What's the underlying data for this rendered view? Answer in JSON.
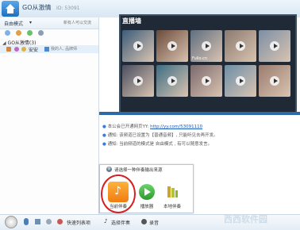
{
  "window": {
    "title": "GO从激情",
    "room_id": "ID: 53091"
  },
  "left_panel": {
    "mode_label": "自由模式",
    "remind_label": "新有人可以交流",
    "group_header": "GO从激情(3)",
    "user": {
      "name": "安安",
      "desc": "我的人, 品牌师"
    }
  },
  "video_area": {
    "title": "直播墙",
    "thumbs": [
      {
        "label": "",
        "color": "#3c5c7a"
      },
      {
        "label": "",
        "color": "#6b4a3a"
      },
      {
        "label": "Fulio.cn",
        "color": "#5f6e80"
      },
      {
        "label": "",
        "color": "#8a7a70"
      },
      {
        "label": "",
        "color": "#7c8fa5"
      },
      {
        "label": "",
        "color": "#4a4f60"
      },
      {
        "label": "",
        "color": "#3d6d84"
      },
      {
        "label": "",
        "color": "#7b6a6f"
      },
      {
        "label": "",
        "color": "#6d8fa8"
      },
      {
        "label": "",
        "color": "#9a7d70"
      }
    ]
  },
  "messages": [
    {
      "prefix": "本公会已开通网页YY:",
      "link": "http://yy.com/53091110"
    },
    {
      "prefix": "通知: 该频道已设置为【普通音频】, 只能听见去再开发。",
      "link": ""
    },
    {
      "prefix": "通知: 当前频道的模式是 自由模式 , 有可以随意发言。",
      "link": ""
    }
  ],
  "popup": {
    "title": "请选择一种伴奏输出来源",
    "options": [
      {
        "label": "当前伴奏"
      },
      {
        "label": "播放器"
      },
      {
        "label": "本地伴奏"
      }
    ]
  },
  "bottom_bar": {
    "btn_tools": "快速列表项",
    "btn_accompany": "选择伴奏",
    "btn_record": "录音"
  },
  "watermark": "西西软件园"
}
